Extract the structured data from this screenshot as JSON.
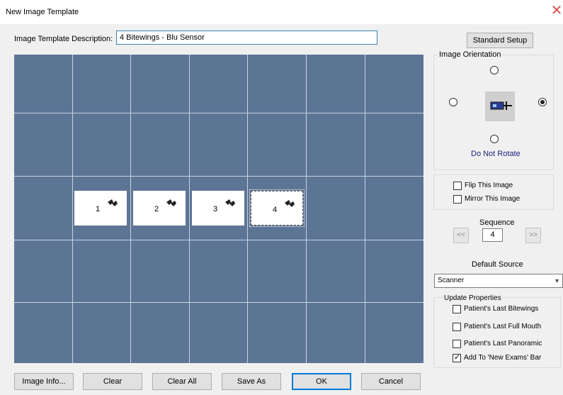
{
  "window": {
    "title": "New Image Template",
    "close_glyph": "✕"
  },
  "description": {
    "label": "Image Template Description:",
    "value": "4 Bitewings - Blu Sensor"
  },
  "standard_setup_label": "Standard Setup",
  "slots": [
    {
      "num": "1",
      "icon": "tooth-pair-icon"
    },
    {
      "num": "2",
      "icon": "tooth-pair-icon"
    },
    {
      "num": "3",
      "icon": "tooth-pair-icon"
    },
    {
      "num": "4",
      "icon": "tooth-pair-icon",
      "selected": true
    }
  ],
  "orientation": {
    "label": "Image Orientation",
    "selected": "right",
    "rotation_text": "Do Not Rotate"
  },
  "flip": {
    "label": "Flip This Image",
    "checked": false
  },
  "mirror": {
    "label": "Mirror This Image",
    "checked": false
  },
  "sequence": {
    "label": "Sequence",
    "prev": "<<",
    "next": ">>",
    "value": "4"
  },
  "default_source": {
    "label": "Default Source",
    "value": "Scanner"
  },
  "update_properties": {
    "label": "Update Properties",
    "items": [
      {
        "label": "Patient's Last Bitewings",
        "checked": false
      },
      {
        "label": "Patient's Last Full Mouth",
        "checked": false
      },
      {
        "label": "Patient's Last Panoramic",
        "checked": false
      },
      {
        "label": "Add To 'New Exams' Bar",
        "checked": true
      }
    ]
  },
  "buttons": {
    "image_info": "Image Info...",
    "clear": "Clear",
    "clear_all": "Clear All",
    "save_as": "Save As",
    "ok": "OK",
    "cancel": "Cancel"
  },
  "colors": {
    "canvas": "#5d7595",
    "grid": "#c9d3e0",
    "accent": "#0078d7"
  }
}
